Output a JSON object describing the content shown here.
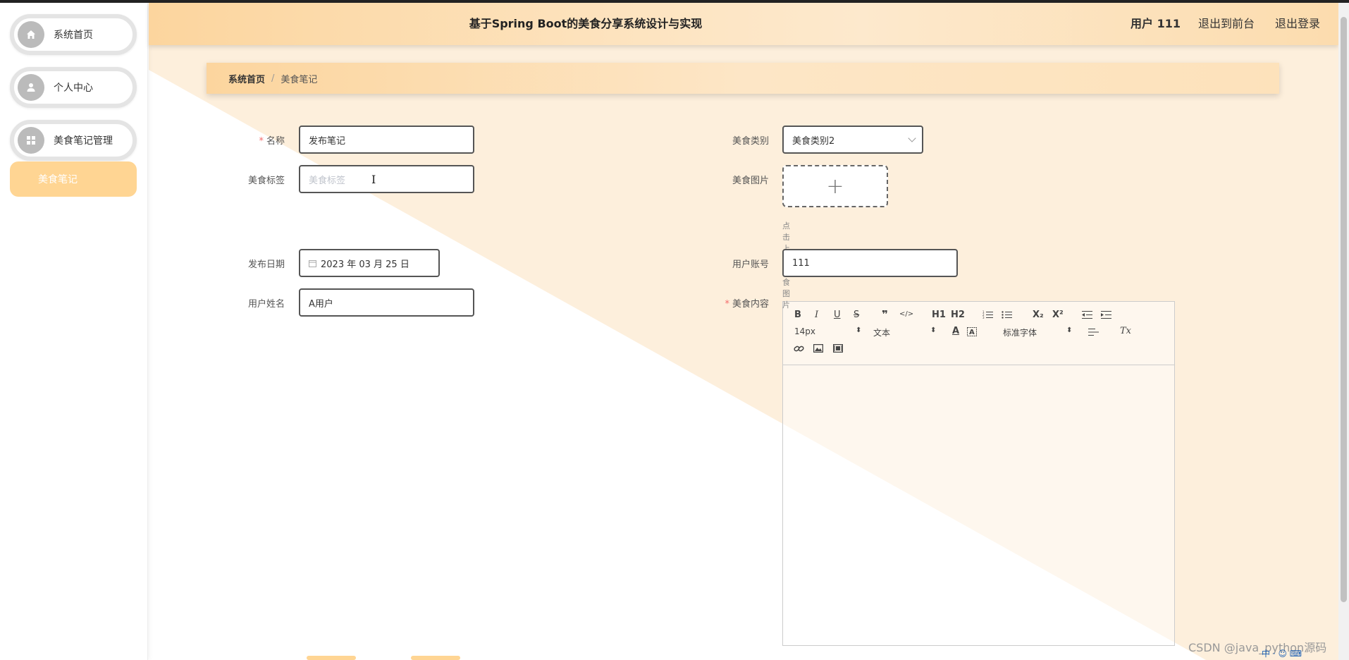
{
  "header": {
    "title": "基于Spring Boot的美食分享系统设计与实现",
    "user_label": "用户 111",
    "front_link": "退出到前台",
    "logout_link": "退出登录"
  },
  "sidebar": {
    "items": [
      {
        "label": "系统首页",
        "icon": "home-icon"
      },
      {
        "label": "个人中心",
        "icon": "user-icon"
      },
      {
        "label": "美食笔记管理",
        "icon": "grid-icon"
      }
    ],
    "sub_item": "美食笔记"
  },
  "breadcrumb": {
    "home": "系统首页",
    "separator": "/",
    "current": "美食笔记"
  },
  "form": {
    "name": {
      "label": "名称",
      "value": "发布笔记",
      "required": true
    },
    "tag": {
      "label": "美食标签",
      "placeholder": "美食标签"
    },
    "date": {
      "label": "发布日期",
      "value": "2023 年 03 月 25 日"
    },
    "username": {
      "label": "用户姓名",
      "value": "A用户"
    },
    "category": {
      "label": "美食类别",
      "value": "美食类别2"
    },
    "image": {
      "label": "美食图片",
      "plus": "+",
      "tip": "点击上传美食图片"
    },
    "account": {
      "label": "用户账号",
      "value": "111"
    },
    "content": {
      "label": "美食内容",
      "required": true
    }
  },
  "editor": {
    "font_size": "14px",
    "paragraph": "文本",
    "font_family": "标准字体",
    "buttons": {
      "bold": "B",
      "italic": "I",
      "underline": "U",
      "strike": "S",
      "quote": "❞",
      "code": "</>",
      "h1": "H1",
      "h2": "H2",
      "sub": "X₂",
      "sup": "X²",
      "color": "A",
      "clean": "Tx"
    }
  },
  "watermark": "CSDN @java_python源码",
  "colors": {
    "accent": "#ffd593",
    "header_start": "#fcd59e",
    "header_mid": "#fde9cd",
    "required": "#f56c6c"
  }
}
